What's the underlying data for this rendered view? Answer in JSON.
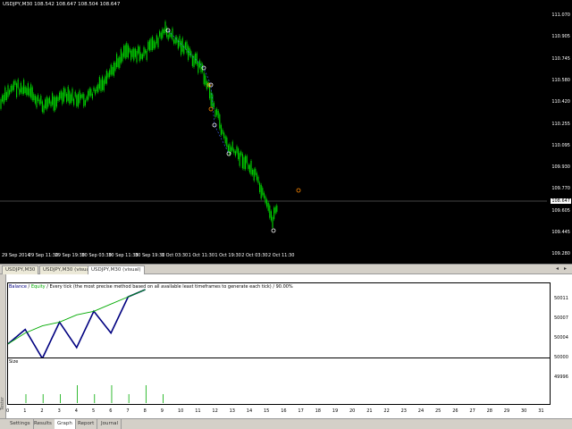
{
  "chart": {
    "title": "USDJPY,M30  108.542 108.647 108.504 108.647",
    "current_price": "108.647",
    "price_labels": [
      "111.070",
      "110.905",
      "110.745",
      "110.580",
      "110.420",
      "110.255",
      "110.095",
      "109.930",
      "109.770",
      "109.605",
      "109.445",
      "109.280"
    ],
    "time_labels": [
      "29 Sep 2014",
      "29 Sep 11:30",
      "29 Sep 19:30",
      "30 Sep 03:30",
      "30 Sep 11:30",
      "30 Sep 19:30",
      "1 Oct 03:30",
      "1 Oct 11:30",
      "1 Oct 19:30",
      "2 Oct 03:30",
      "2 Oct 11:30"
    ],
    "candle_color": "#00cc00",
    "bg_color": "#000000"
  },
  "chart_tabs": [
    {
      "label": "USDJPY,M30"
    },
    {
      "label": "USDJPY,M30 (visual)"
    },
    {
      "label": "USDJPY,M30 (visual)"
    }
  ],
  "tester": {
    "side_label": "Tester",
    "legend_balance": "Balance",
    "legend_sep1": " / ",
    "legend_equity": "Equity",
    "legend_rest": " / Every tick (the most precise method based on all available least timeframes to generate each tick)  / 90.00%",
    "balance_color": "#000080",
    "equity_color": "#00aa00",
    "equity_labels": [
      "50011",
      "50007",
      "50004",
      "50000",
      "49996"
    ],
    "size_label": "Size",
    "x_labels": [
      "0",
      "1",
      "2",
      "3",
      "4",
      "5",
      "6",
      "7",
      "8",
      "9",
      "10",
      "11",
      "12",
      "13",
      "14",
      "15",
      "16",
      "17",
      "18",
      "19",
      "20",
      "21",
      "22",
      "23",
      "24",
      "25",
      "26",
      "27",
      "28",
      "29",
      "30",
      "31"
    ]
  },
  "chart_data": {
    "type": "line",
    "x": [
      0,
      1,
      2,
      3,
      4,
      5,
      6,
      7,
      8
    ],
    "series": [
      {
        "name": "Balance",
        "values": [
          49999,
          50003,
          49995,
          50005,
          49998,
          50008,
          50002,
          50012,
          50014
        ]
      },
      {
        "name": "Equity",
        "values": [
          49999,
          50002,
          50004,
          50005,
          50007,
          50008,
          50010,
          50012,
          50014
        ]
      }
    ],
    "size_values": [
      1,
      1,
      1,
      2,
      1,
      2,
      1,
      2,
      1
    ],
    "ylim": [
      49995,
      50014
    ],
    "xlim": [
      0,
      31
    ]
  },
  "bottom_tabs": [
    {
      "label": "Settings"
    },
    {
      "label": "Results"
    },
    {
      "label": "Graph"
    },
    {
      "label": "Report"
    },
    {
      "label": "Journal"
    }
  ]
}
